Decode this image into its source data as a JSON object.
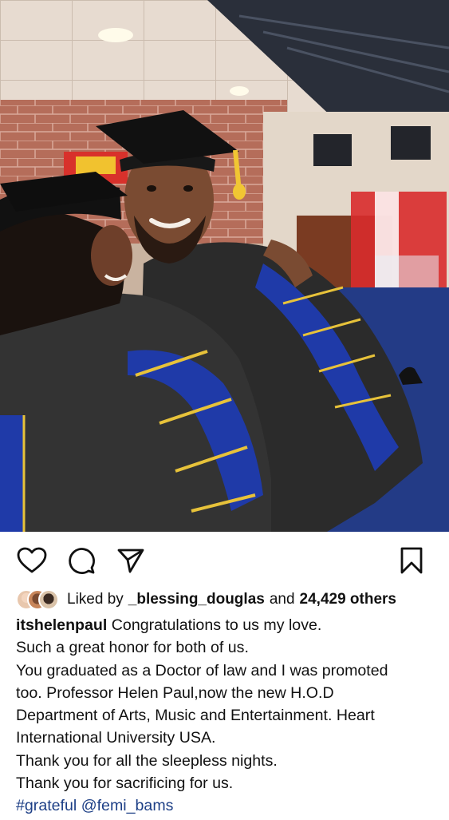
{
  "post": {
    "image_alt": "",
    "actions": {
      "like_icon": "heart-icon",
      "comment_icon": "comment-bubble-icon",
      "share_icon": "paper-plane-icon",
      "save_icon": "bookmark-icon"
    },
    "likes": {
      "prefix": "Liked by",
      "user": "_blessing_douglas",
      "middle": "and",
      "count": "24,429 others"
    },
    "caption": {
      "username": "itshelenpaul",
      "lines": [
        "Congratulations to us my love.",
        "Such a great honor for both of us.",
        "You graduated as a Doctor of law and I was promoted",
        "too. Professor Helen Paul,now the new H.O.D",
        "Department of Arts, Music and Entertainment. Heart",
        "International University USA.",
        "Thank you for all the sleepless nights.",
        "Thank you for sacrificing for us."
      ],
      "hashtag": "#grateful",
      "mention": "@femi_bams"
    }
  },
  "colors": {
    "link": "#1d3f86",
    "text": "#111111",
    "robe_blue": "#1f3aa8",
    "robe_black": "#2b2b2b",
    "gold": "#e7c23a"
  }
}
